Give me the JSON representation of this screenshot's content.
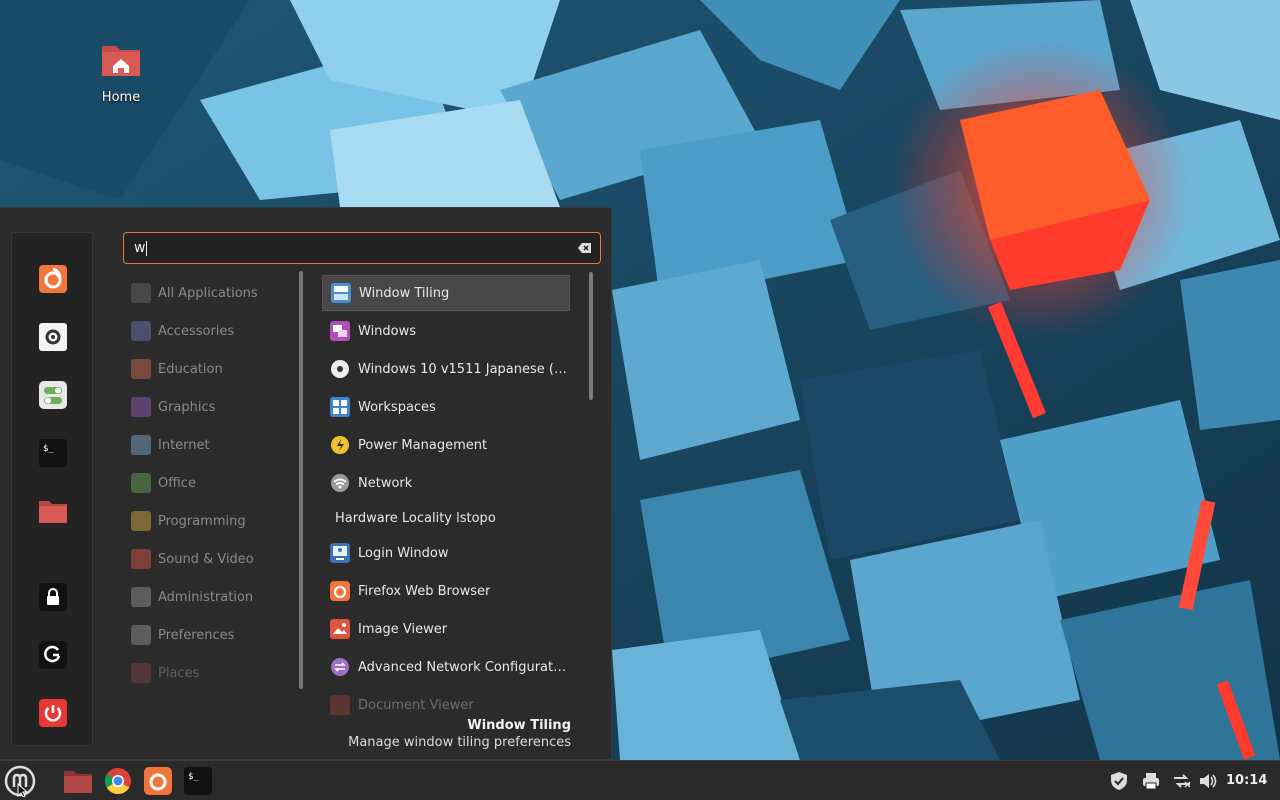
{
  "desktop": {
    "icons": [
      {
        "label": "Home"
      }
    ]
  },
  "menu": {
    "search": {
      "value": "w",
      "placeholder": ""
    },
    "favorites": [
      {
        "name": "firefox-icon"
      },
      {
        "name": "settings-icon"
      },
      {
        "name": "toggle-settings-icon"
      },
      {
        "name": "terminal-icon"
      },
      {
        "name": "folder-icon"
      },
      {
        "name": "lock-icon"
      },
      {
        "name": "logout-icon"
      },
      {
        "name": "power-icon"
      }
    ],
    "categories": [
      {
        "label": "All Applications",
        "color": "#6a6a6a"
      },
      {
        "label": "Accessories",
        "color": "#6d7fbf"
      },
      {
        "label": "Education",
        "color": "#d77153"
      },
      {
        "label": "Graphics",
        "color": "#9d5fc4"
      },
      {
        "label": "Internet",
        "color": "#7fb1d8"
      },
      {
        "label": "Office",
        "color": "#6fae58"
      },
      {
        "label": "Programming",
        "color": "#e2b44a"
      },
      {
        "label": "Sound & Video",
        "color": "#e5584f"
      },
      {
        "label": "Administration",
        "color": "#9a9a9a"
      },
      {
        "label": "Preferences",
        "color": "#9a9a9a"
      },
      {
        "label": "Places",
        "color": "#d45c5c"
      }
    ],
    "apps": [
      {
        "label": "Window Tiling",
        "icon": "window-tiling-icon",
        "color": "#4b8fcf",
        "selected": true
      },
      {
        "label": "Windows",
        "icon": "windows-icon",
        "color": "#b14fb7"
      },
      {
        "label": "Windows 10 v1511 Japanese (x...",
        "icon": "disc-icon",
        "color": "#eeeeee"
      },
      {
        "label": "Workspaces",
        "icon": "workspaces-icon",
        "color": "#3e86cf"
      },
      {
        "label": "Power Management",
        "icon": "power-management-icon",
        "color": "#f2c12e"
      },
      {
        "label": "Network",
        "icon": "network-icon",
        "color": "#9a9a9a"
      },
      {
        "label": "Hardware Locality lstopo",
        "icon": "",
        "color": ""
      },
      {
        "label": "Login Window",
        "icon": "login-window-icon",
        "color": "#3d6fb3"
      },
      {
        "label": "Firefox Web Browser",
        "icon": "firefox-icon",
        "color": "#f0763b"
      },
      {
        "label": "Image Viewer",
        "icon": "image-viewer-icon",
        "color": "#e0533f"
      },
      {
        "label": "Advanced Network Configuration",
        "icon": "network-config-icon",
        "color": "#9b6fc4"
      },
      {
        "label": "Document Viewer",
        "icon": "document-viewer-icon",
        "color": "#c04a3d"
      }
    ],
    "description": {
      "title": "Window Tiling",
      "subtitle": "Manage window tiling preferences"
    }
  },
  "taskbar": {
    "launchers": [
      {
        "name": "files-launcher"
      },
      {
        "name": "chrome-launcher"
      },
      {
        "name": "firefox-launcher"
      },
      {
        "name": "terminal-launcher"
      }
    ],
    "tray": [
      {
        "name": "shield-icon"
      },
      {
        "name": "printer-icon"
      },
      {
        "name": "network-tray-icon"
      },
      {
        "name": "volume-icon"
      }
    ],
    "clock": "10:14"
  },
  "colors": {
    "accent": "#e27d3a",
    "menu_bg": "#2b2b2b",
    "taskbar_bg": "#2a2a2a"
  }
}
